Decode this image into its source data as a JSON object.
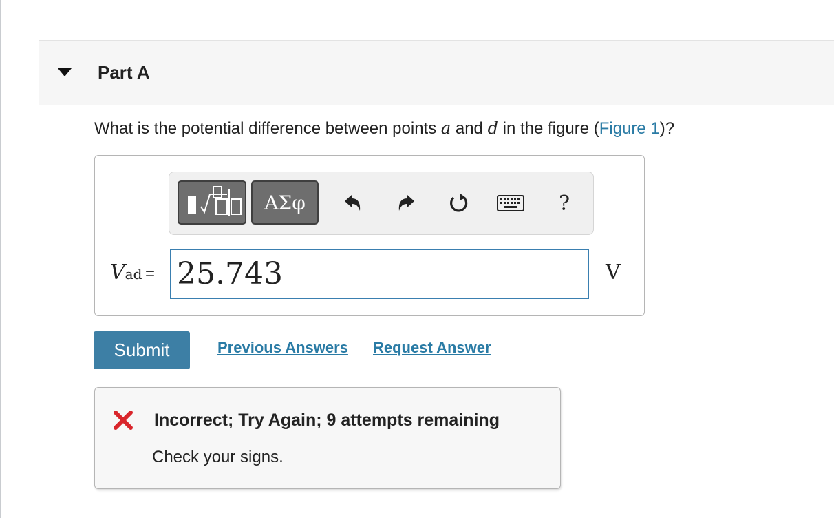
{
  "part": {
    "title": "Part A"
  },
  "question": {
    "text_before": "What is the potential difference between points ",
    "var_a": "a",
    "text_mid": " and ",
    "var_d": "d",
    "text_after": " in the figure (",
    "figure_link": "Figure 1",
    "text_end": ")?"
  },
  "toolbar": {
    "greek_label": "ΑΣφ",
    "help_label": "?",
    "icons": [
      "templates-icon",
      "undo-icon",
      "redo-icon",
      "reset-icon",
      "keyboard-icon",
      "help-icon"
    ]
  },
  "equation": {
    "var": "V",
    "sub": "ad",
    "equals": "=",
    "value": "25.743",
    "unit": "V"
  },
  "actions": {
    "submit_label": "Submit",
    "previous_answers_label": "Previous Answers",
    "request_answer_label": "Request Answer"
  },
  "feedback": {
    "title": "Incorrect; Try Again; 9 attempts remaining",
    "message": "Check your signs."
  },
  "colors": {
    "accent": "#3d7fa5",
    "link": "#2a7ba5",
    "error": "#d9262c",
    "input_border": "#3a7fb0"
  }
}
